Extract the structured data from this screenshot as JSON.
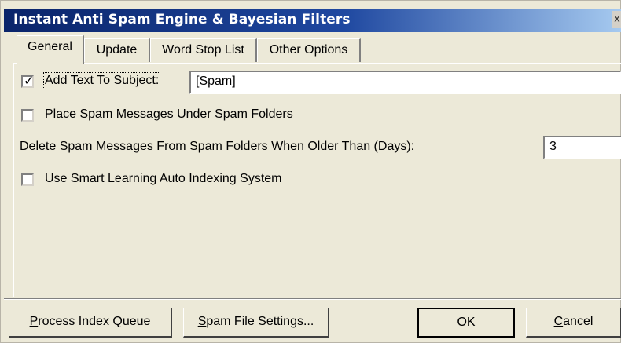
{
  "window": {
    "title": "Instant Anti Spam Engine & Bayesian Filters",
    "close_symbol": "x"
  },
  "tabs": [
    {
      "label": "General",
      "active": true
    },
    {
      "label": "Update",
      "active": false
    },
    {
      "label": "Word Stop List",
      "active": false
    },
    {
      "label": "Other Options",
      "active": false
    }
  ],
  "general": {
    "add_text": {
      "label": "Add Text To Subject:",
      "checked": true,
      "value": "[Spam]"
    },
    "place_spam": {
      "label": "Place Spam Messages Under Spam Folders",
      "checked": false
    },
    "delete_older": {
      "label": "Delete Spam Messages From Spam Folders When Older Than (Days):",
      "value": "3"
    },
    "smart_learning": {
      "label": "Use Smart Learning Auto Indexing System",
      "checked": false
    }
  },
  "buttons": {
    "process_index": {
      "mnemonic": "P",
      "rest": "rocess Index Queue"
    },
    "spam_file_settings": {
      "mnemonic": "S",
      "rest": "pam File Settings..."
    },
    "ok": {
      "mnemonic": "O",
      "rest": "K"
    },
    "cancel": {
      "mnemonic": "C",
      "rest": "ancel"
    }
  },
  "icons": {
    "check": "check-icon"
  }
}
